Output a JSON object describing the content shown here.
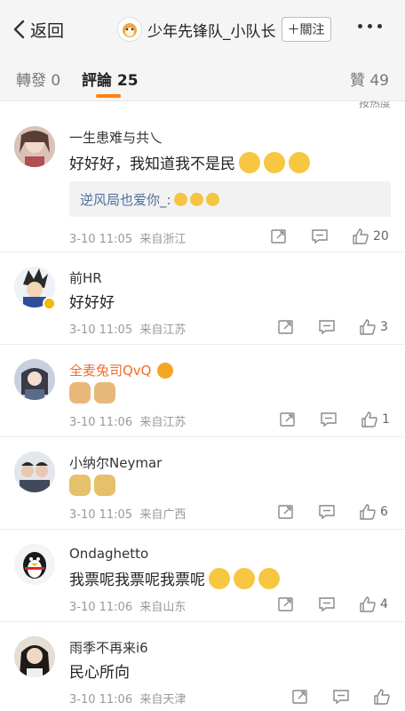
{
  "header": {
    "back_label": "返回",
    "blog_name": "少年先锋队_小队长",
    "follow_label": "＋關注"
  },
  "tabs": {
    "repost": "轉發 0",
    "comments": "評論 25",
    "likes": "贊 49"
  },
  "sort_label": "按热度",
  "comments": [
    {
      "username": "一生患难与共乀",
      "text": "好好好，我知道我不是民",
      "reply_author": "逆风局也爱你_:",
      "time": "3-10 11:05",
      "location": "来自浙江",
      "likes": "20"
    },
    {
      "username": "前HR",
      "text": "好好好",
      "time": "3-10 11:05",
      "location": "来自江苏",
      "likes": "3"
    },
    {
      "username": "全麦兔司QvQ",
      "text": "",
      "time": "3-10 11:06",
      "location": "来自江苏",
      "likes": "1"
    },
    {
      "username": "小纳尔Neymar",
      "text": "",
      "time": "3-10 11:05",
      "location": "来自广西",
      "likes": "6"
    },
    {
      "username": "Ondaghetto",
      "text": "我票呢我票呢我票呢",
      "time": "3-10 11:06",
      "location": "来自山东",
      "likes": "4"
    },
    {
      "username": "雨季不再来i6",
      "text": "民心所向",
      "time": "3-10 11:06",
      "location": "来自天津",
      "likes": ""
    }
  ],
  "colors": {
    "accent": "#ff8200",
    "vip_name": "#f26d27",
    "reply_link": "#4d6f9c"
  },
  "icons": [
    "back-arrow-icon",
    "more-icon",
    "repost-icon",
    "comment-icon",
    "like-icon",
    "emoji-icon"
  ]
}
